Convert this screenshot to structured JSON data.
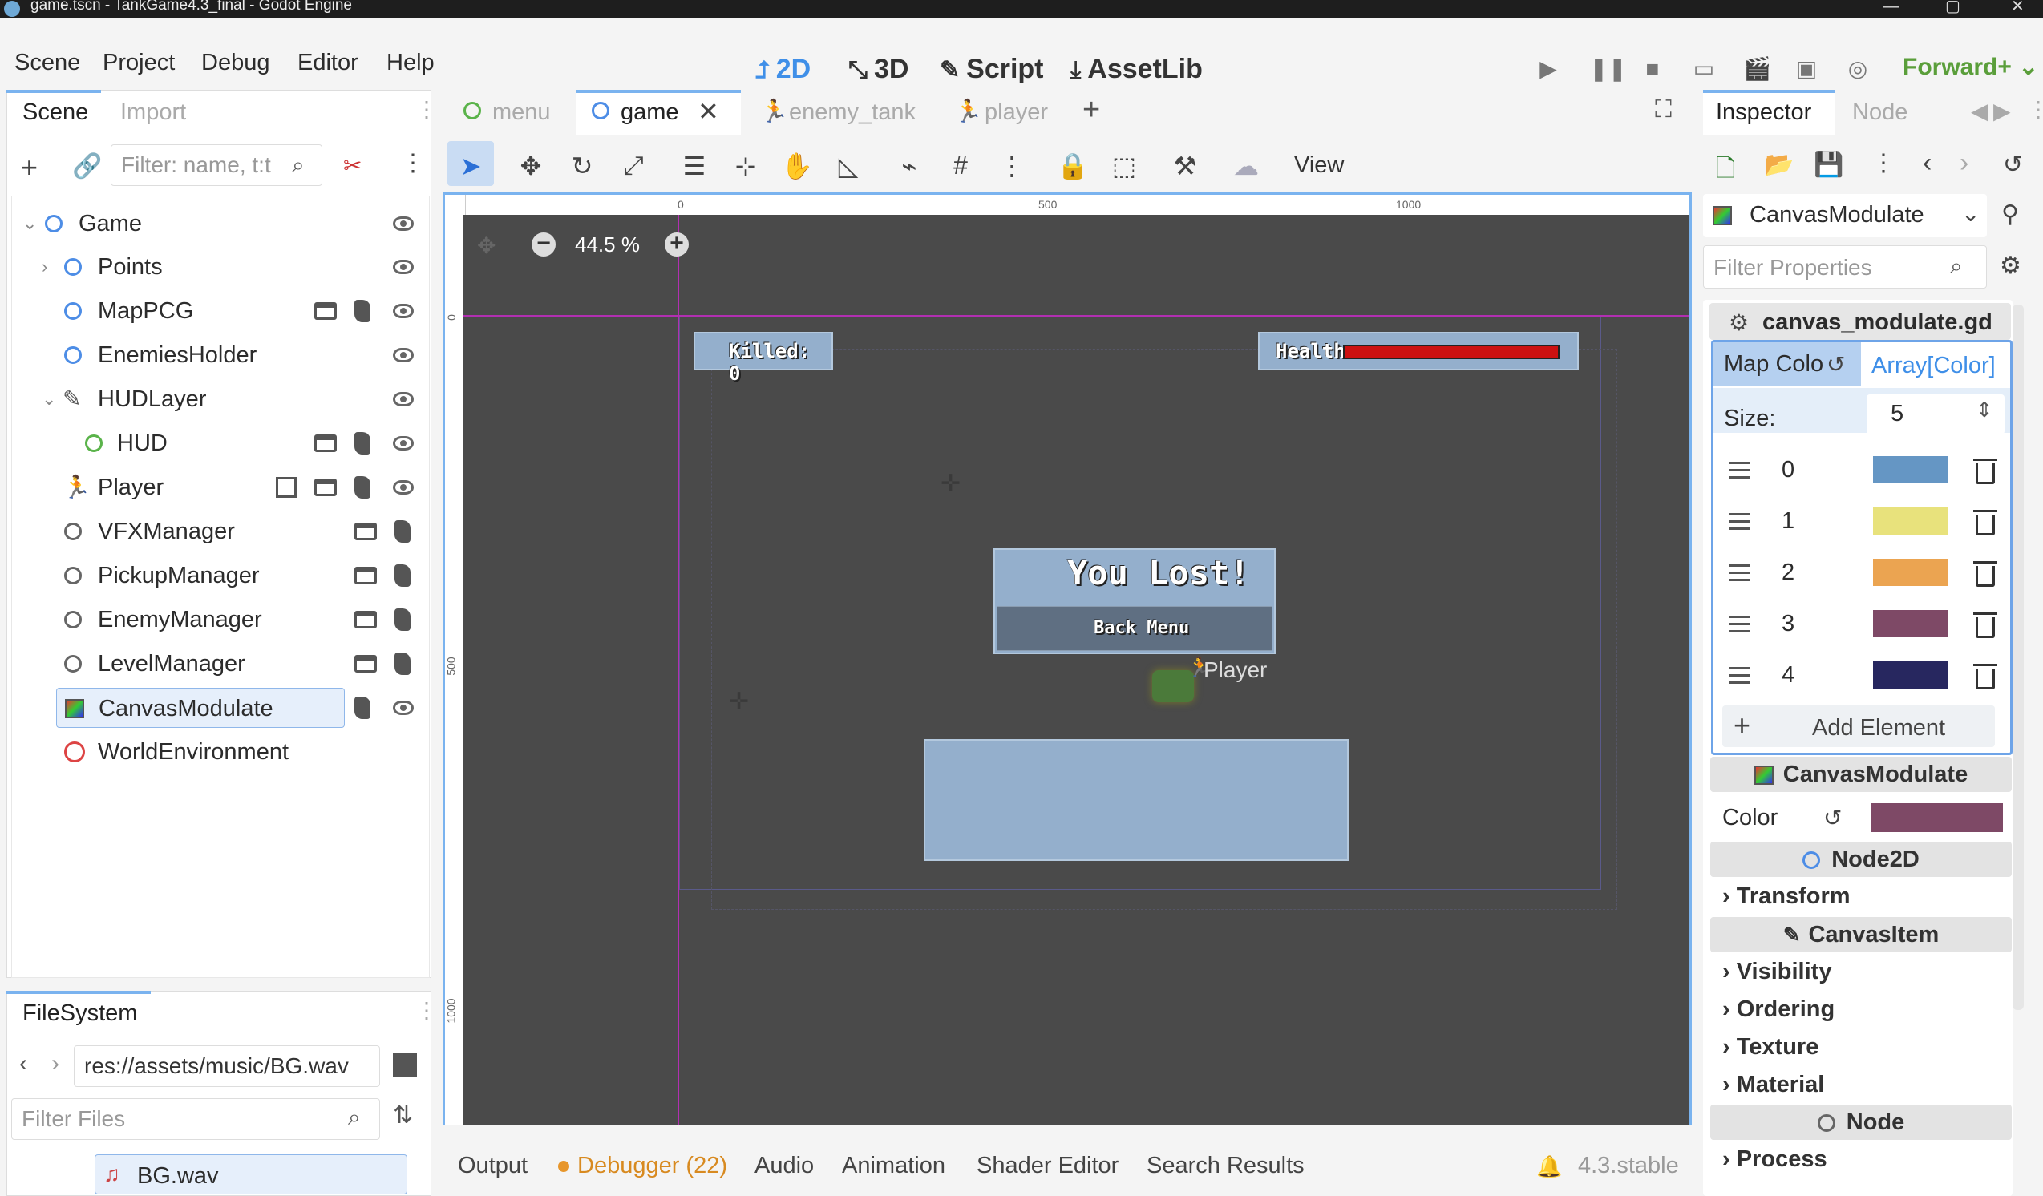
{
  "window": {
    "title": "game.tscn - TankGame4.3_final - Godot Engine"
  },
  "menu": {
    "items": [
      "Scene",
      "Project",
      "Debug",
      "Editor",
      "Help"
    ]
  },
  "modes": {
    "2d": "2D",
    "3d": "3D",
    "script": "Script",
    "assetlib": "AssetLib"
  },
  "renderer": "Forward+",
  "left_top_tabs": {
    "scene": "Scene",
    "import": "Import"
  },
  "scene_filter_placeholder": "Filter: name, t:t",
  "scene_tree": [
    {
      "label": "Game"
    },
    {
      "label": "Points"
    },
    {
      "label": "MapPCG"
    },
    {
      "label": "EnemiesHolder"
    },
    {
      "label": "HUDLayer"
    },
    {
      "label": "HUD"
    },
    {
      "label": "Player"
    },
    {
      "label": "VFXManager"
    },
    {
      "label": "PickupManager"
    },
    {
      "label": "EnemyManager"
    },
    {
      "label": "LevelManager"
    },
    {
      "label": "CanvasModulate"
    },
    {
      "label": "WorldEnvironment"
    }
  ],
  "filesystem": {
    "tab": "FileSystem",
    "path": "res://assets/music/BG.wav",
    "filter_placeholder": "Filter Files",
    "file": "BG.wav"
  },
  "editor_tabs": [
    "menu",
    "game",
    "enemy_tank",
    "player"
  ],
  "toolbar": {
    "view": "View"
  },
  "viewport": {
    "zoom": "44.5 %",
    "ruler_marks": [
      "0",
      "500",
      "1000"
    ],
    "vruler_marks": [
      "0",
      "500",
      "1000"
    ],
    "killed_text": "Killed: 0",
    "health_text": "Health",
    "you_lost": "You Lost!",
    "back_menu": "Back Menu",
    "player_label": "Player",
    "health_fill": 1.0
  },
  "bottom_tabs": [
    "Output",
    "Debugger (22)",
    "Audio",
    "Animation",
    "Shader Editor",
    "Search Results"
  ],
  "version": "4.3.stable",
  "inspector": {
    "tabs": {
      "inspector": "Inspector",
      "node": "Node"
    },
    "object": "CanvasModulate",
    "filter_placeholder": "Filter Properties",
    "script_name": "canvas_modulate.gd",
    "map_color_label": "Map Colo",
    "array_type": "Array[Color]",
    "size_label": "Size:",
    "size_value": "5",
    "elements": [
      {
        "index": "0",
        "color": "#6596c4"
      },
      {
        "index": "1",
        "color": "#e8e27c"
      },
      {
        "index": "2",
        "color": "#eba451"
      },
      {
        "index": "3",
        "color": "#7e4966"
      },
      {
        "index": "4",
        "color": "#27275f"
      }
    ],
    "add_element": "Add Element",
    "section_canvasmodulate": "CanvasModulate",
    "color_label": "Color",
    "color_value": "#7e4966",
    "section_node2d": "Node2D",
    "transform": "Transform",
    "section_canvasitem": "CanvasItem",
    "categories": [
      "Visibility",
      "Ordering",
      "Texture",
      "Material"
    ],
    "section_node": "Node",
    "process": "Process"
  }
}
